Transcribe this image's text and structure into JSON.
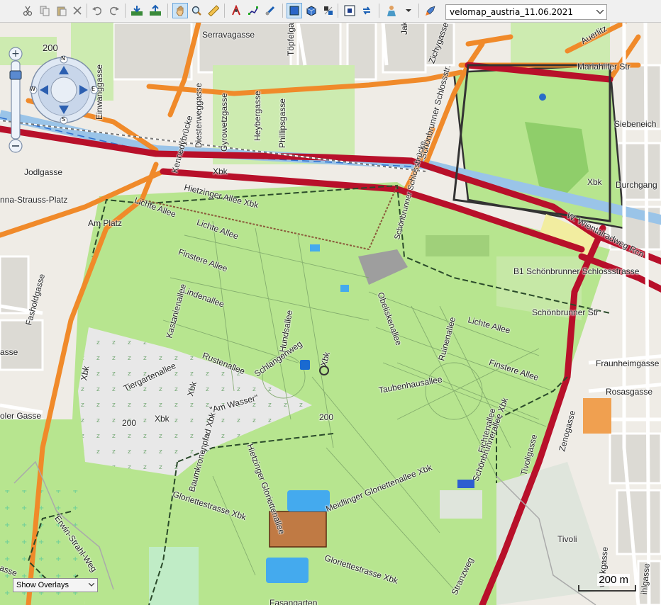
{
  "toolbar": {
    "map_selector_value": "velomap_austria_11.06.2021",
    "icons": [
      "cut-icon",
      "copy-icon",
      "paste-icon",
      "delete-icon",
      "undo-icon",
      "redo-icon",
      "receive-icon",
      "send-icon",
      "pan-icon",
      "zoom-icon",
      "measure-icon",
      "route-icon",
      "track-icon",
      "waypoint-icon",
      "select-icon",
      "3d-icon",
      "layers-icon",
      "fit-icon",
      "sync-icon",
      "user-icon",
      "rocket-icon"
    ]
  },
  "map": {
    "zoom_scale_value": "200",
    "compass": {
      "n": "N",
      "s": "S",
      "e": "E",
      "w": "W"
    },
    "labels": {
      "serravagasse": "Serravagasse",
      "topfelgasse": "Töpfelgasse",
      "einwanggasse": "Einwanggasse",
      "diesterweggasse": "Diesterweggasse",
      "gyrowetzgasse": "Gyrowetzgasse",
      "heybergasse": "Heybergasse",
      "phillipsgasse": "Phillipsgasse",
      "jak": "Jak",
      "zichygasse": "Zichygasse",
      "schonbrunnerschlossstr": "Schönbrunner Schlossstr.",
      "mariahilfer": "Mariahilfer Str",
      "auerlitz": "Auerlitz",
      "siebeneich": "Siebeneich",
      "durchgang": "Durchgang",
      "xbk1": "Xbk",
      "xbk2": "Xbk",
      "xbk3": "Xbk",
      "xbk4": "Xbk",
      "xbk5": "Xbk",
      "xbk6": "Xbk",
      "jodlgasse": "Jodlgasse",
      "kennedybrucke": "Kennedybrücke",
      "hietzingerallee": "Hietzinger Allee Xbk",
      "strausplatz": "nna-Strauss-Platz",
      "amplatz": "Am Platz",
      "lichteallee1": "Lichte Allee",
      "lichteallee2": "Lichte Allee",
      "lichteallee3": "Lichte Allee",
      "finstereallee1": "Finstere Allee",
      "finstereallee2": "Finstere Allee",
      "lindenallee": "Lindenallee",
      "kastanienallee": "Kastanienallee",
      "hundsallee": "Hundsallee",
      "obeliskenallee": "Obeliskenallee",
      "ruinenallee": "Ruinenallee",
      "rustenallee": "Rustenallee",
      "schlangenweg": "Schlangenweg",
      "tiergartenallee": "Tiergartenallee",
      "amwasser": "\"Am Wasser\"",
      "taubenhausallee": "Taubenhausallee",
      "fichtenallee": "Fichtenallee",
      "schonbrunnerstr": "Schönbrunner Str",
      "b1": "B1 Schönbrunner Schlossstrasse",
      "wientalradweg": "W. Wientalradweg Rcn",
      "schonbrunnerschlossbrucke": "Schönbrunner Schlossbrücke",
      "fasholdgasse": "Fasholdgasse",
      "asse": "asse",
      "olergasse": "oler Gasse",
      "fraunheimgasse": "Fraunheimgasse",
      "rosasgasse": "Rosasgasse",
      "zenogasse": "Zenogasse",
      "tivoligasse": "Tivoligasse",
      "tivoli": "Tivoli",
      "baumkronenpfad": "Baumkronenpfad Xbk",
      "hietzingergloriette": "Hietzinger Gloriettenallee",
      "meidlingergloriette": "Meidlinger Gloriettenallee Xbk",
      "gloriettestrasse1": "Gloriettestrasse Xbk",
      "gloriettestrasse2": "Gloriettestrasse Xbk",
      "schonbrunnerallee": "Schönbrunnerallee Xbk",
      "erwinstrahweg": "Erwin-Strahl-Weg",
      "stranzweg": "Stranzweg",
      "fasangarten": "Fasangarten",
      "werkgasse": "werkgasse",
      "ihlgasse": "ihlgasse",
      "contour200a": "200",
      "contour200b": "200",
      "sesse": "asse"
    },
    "overlay_button": "Show Overlays",
    "scale_bar": "200 m"
  }
}
